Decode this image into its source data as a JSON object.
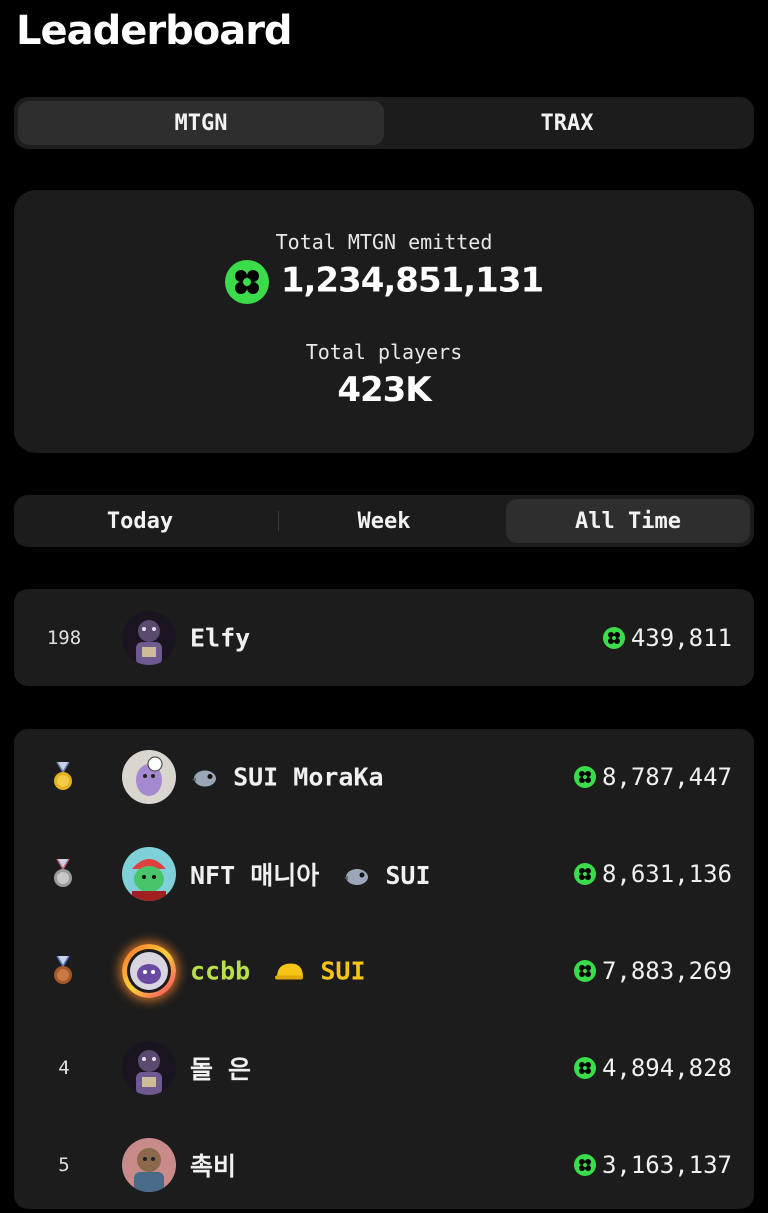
{
  "page": {
    "title": "Leaderboard"
  },
  "token_tabs": [
    {
      "label": "MTGN",
      "active": true
    },
    {
      "label": "TRAX",
      "active": false
    }
  ],
  "stats": {
    "emitted_label": "Total MTGN emitted",
    "emitted_value": "1,234,851,131",
    "players_label": "Total players",
    "players_value": "423K",
    "coin_icon": "mtgn-coin-icon",
    "accent_color": "#3bdc4a"
  },
  "period_tabs": [
    {
      "label": "Today",
      "active": false
    },
    {
      "label": "Week",
      "active": false
    },
    {
      "label": "All Time",
      "active": true
    }
  ],
  "my_rank": {
    "rank": "198",
    "name": "Elfy",
    "score": "439,811"
  },
  "leaders": [
    {
      "rank": "1",
      "medal": "gold-medal-icon",
      "name": "SUI MoraKa",
      "prefix_icon": "sui-bird-icon",
      "score": "8,787,447"
    },
    {
      "rank": "2",
      "medal": "silver-medal-icon",
      "name": "NFT 매니아",
      "suffix_icon": "sui-bird-icon",
      "suffix": "SUI",
      "score": "8,631,136"
    },
    {
      "rank": "3",
      "medal": "bronze-medal-icon",
      "name": "ccbb",
      "suffix_icon": "yellow-cap-icon",
      "suffix": "SUI",
      "name_color": "#b8e04a",
      "score": "7,883,269"
    },
    {
      "rank": "4",
      "name": "돌 은",
      "score": "4,894,828"
    },
    {
      "rank": "5",
      "name": "촉비",
      "score": "3,163,137"
    }
  ]
}
